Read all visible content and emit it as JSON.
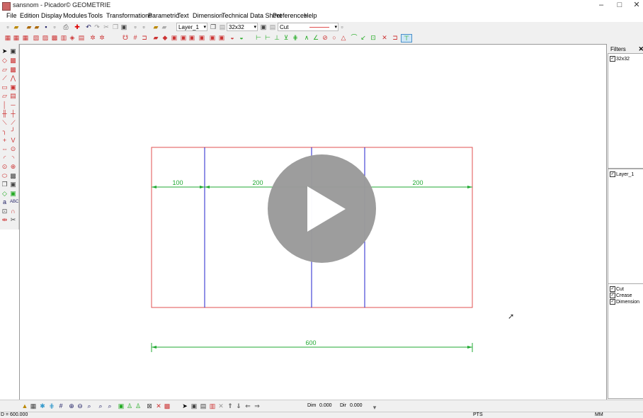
{
  "window": {
    "title": "sansnom - Picador© GEOMETRIE",
    "min_glyph": "–",
    "max_glyph": "□",
    "close_glyph": "✕"
  },
  "menu": [
    "File",
    "Edition",
    "Display",
    "Modules",
    "Tools",
    "Transformations",
    "Parametric",
    "Text",
    "Dimension",
    "Technical Data Sheet",
    "Preferences",
    "Help"
  ],
  "toolbar": {
    "layer": "Layer_1",
    "size": "32x32",
    "line_type": "Cut"
  },
  "filters": {
    "header": "Filters",
    "close": "✕",
    "group1": [
      "32x32"
    ],
    "group2": [
      "Layer_1"
    ],
    "group3": [
      "Cut",
      "Crease",
      "Dimension"
    ],
    "checked_glyph": "✓"
  },
  "drawing": {
    "colors": {
      "cut": "#e05050",
      "crease": "#2020cc",
      "dimension": "#22aa33"
    },
    "dimensions": [
      "100",
      "200",
      "200",
      "600"
    ]
  },
  "bottom": {
    "dim_label": "Dim",
    "dim_value": "0.000",
    "dir_label": "Dir",
    "dir_value": "0.000"
  },
  "status": {
    "coord": "D = 600.000",
    "mode": "PTS",
    "unit": "MM"
  }
}
